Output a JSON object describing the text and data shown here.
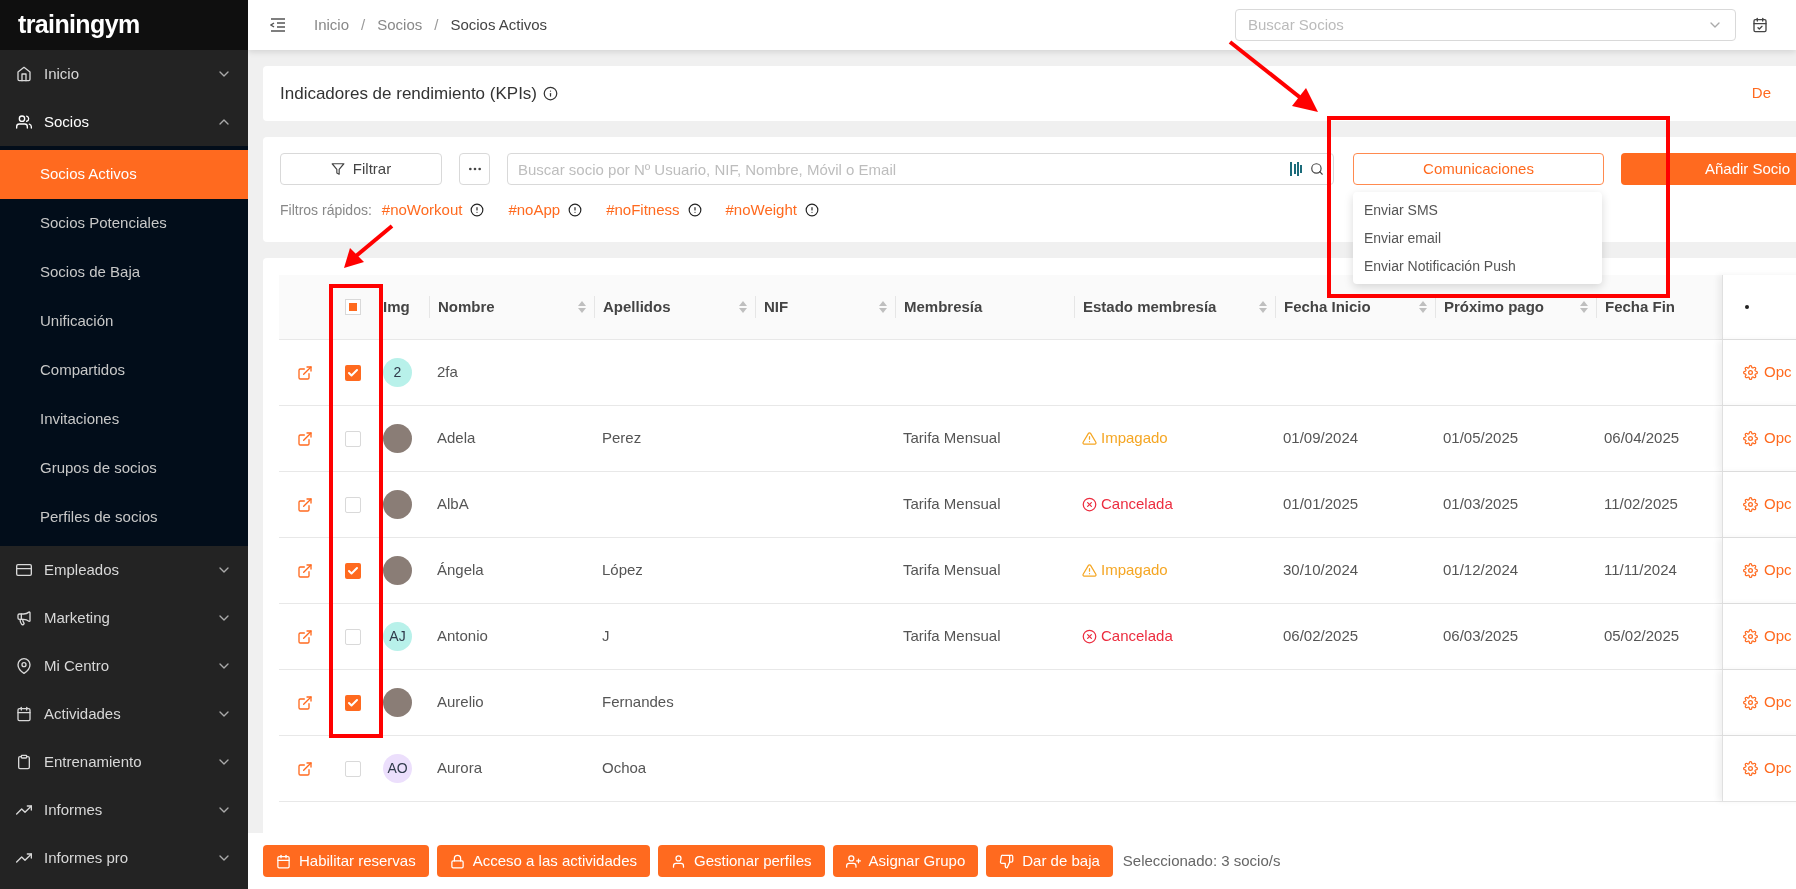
{
  "brand": {
    "name": "trainingym"
  },
  "sidebar": {
    "items": [
      {
        "label": "Inicio",
        "expanded": false
      },
      {
        "label": "Socios",
        "expanded": true,
        "children": [
          {
            "label": "Socios Activos",
            "selected": true
          },
          {
            "label": "Socios Potenciales",
            "selected": false
          },
          {
            "label": "Socios de Baja",
            "selected": false
          },
          {
            "label": "Unificación",
            "selected": false
          },
          {
            "label": "Compartidos",
            "selected": false
          },
          {
            "label": "Invitaciones",
            "selected": false
          },
          {
            "label": "Grupos de socios",
            "selected": false
          },
          {
            "label": "Perfiles de socios",
            "selected": false
          }
        ]
      },
      {
        "label": "Empleados",
        "expanded": false
      },
      {
        "label": "Marketing",
        "expanded": false
      },
      {
        "label": "Mi Centro",
        "expanded": false
      },
      {
        "label": "Actividades",
        "expanded": false
      },
      {
        "label": "Entrenamiento",
        "expanded": false
      },
      {
        "label": "Informes",
        "expanded": false
      },
      {
        "label": "Informes pro",
        "expanded": false
      }
    ]
  },
  "header": {
    "breadcrumb": [
      "Inicio",
      "Socios",
      "Socios Activos"
    ],
    "breadcrumb_separators": [
      "/",
      "/"
    ],
    "member_search": {
      "placeholder": "Buscar Socios"
    }
  },
  "kpi_panel": {
    "title": "Indicadores de rendimiento (KPIs)",
    "link": "De"
  },
  "toolbar": {
    "filter_button": "Filtrar",
    "search": {
      "placeholder": "Buscar socio por Nº Usuario, NIF, Nombre, Móvil o Email"
    },
    "communications_button": "Comunicaciones",
    "communications_menu": {
      "expanded": true,
      "items": [
        "Enviar SMS",
        "Enviar email",
        "Enviar Notificación Push"
      ]
    },
    "add_button": "Añadir Socio"
  },
  "quick_filters": {
    "label": "Filtros rápidos:",
    "tags": [
      "#noWorkout",
      "#noApp",
      "#noFitness",
      "#noWeight"
    ]
  },
  "table": {
    "select_all": {
      "indeterminate": true
    },
    "columns": [
      {
        "label": "Img",
        "sortable": false
      },
      {
        "label": "Nombre",
        "sortable": true
      },
      {
        "label": "Apellidos",
        "sortable": true
      },
      {
        "label": "NIF",
        "sortable": true
      },
      {
        "label": "Membresía",
        "sortable": false
      },
      {
        "label": "Estado membresía",
        "sortable": true
      },
      {
        "label": "Fecha Inicio",
        "sortable": true
      },
      {
        "label": "Próximo pago",
        "sortable": true
      },
      {
        "label": "Fecha Fin",
        "sortable": false
      }
    ],
    "rows": [
      {
        "checked": true,
        "avatar": {
          "kind": "initials",
          "text": "2",
          "color": "#b8f1ea"
        },
        "nombre": "2fa",
        "action": "Opc"
      },
      {
        "checked": false,
        "avatar": {
          "kind": "photo"
        },
        "nombre": "Adela",
        "apellidos": "Perez",
        "membresia": "Tarifa Mensual",
        "estado": {
          "kind": "warning",
          "text": "Impagado"
        },
        "fecha_inicio": "01/09/2024",
        "proximo_pago": "01/05/2025",
        "fecha_fin": "06/04/2025",
        "action": "Opc"
      },
      {
        "checked": false,
        "avatar": {
          "kind": "photo"
        },
        "nombre": "AlbA",
        "membresia": "Tarifa Mensual",
        "estado": {
          "kind": "error",
          "text": "Cancelada"
        },
        "fecha_inicio": "01/01/2025",
        "proximo_pago": "01/03/2025",
        "fecha_fin": "11/02/2025",
        "action": "Opc"
      },
      {
        "checked": true,
        "avatar": {
          "kind": "photo"
        },
        "nombre": "Ángela",
        "apellidos": "López",
        "membresia": "Tarifa Mensual",
        "estado": {
          "kind": "warning",
          "text": "Impagado"
        },
        "fecha_inicio": "30/10/2024",
        "proximo_pago": "01/12/2024",
        "fecha_fin": "11/11/2024",
        "action": "Opc"
      },
      {
        "checked": false,
        "avatar": {
          "kind": "initials",
          "text": "AJ",
          "color": "#b8f1ea"
        },
        "nombre": "Antonio",
        "apellidos": "J",
        "membresia": "Tarifa Mensual",
        "estado": {
          "kind": "error",
          "text": "Cancelada"
        },
        "fecha_inicio": "06/02/2025",
        "proximo_pago": "06/03/2025",
        "fecha_fin": "05/02/2025",
        "action": "Opc"
      },
      {
        "checked": true,
        "avatar": {
          "kind": "photo"
        },
        "nombre": "Aurelio",
        "apellidos": "Fernandes",
        "action": "Opc"
      },
      {
        "checked": false,
        "avatar": {
          "kind": "initials",
          "text": "AO",
          "color": "#ecdffc"
        },
        "nombre": "Aurora",
        "apellidos": "Ochoa",
        "action": "Opc"
      }
    ]
  },
  "bulk_actions": {
    "buttons": [
      "Habilitar reservas",
      "Acceso a las actividades",
      "Gestionar perfiles",
      "Asignar Grupo",
      "Dar de baja"
    ],
    "selection": "Seleccionado: 3 socio/s"
  }
}
